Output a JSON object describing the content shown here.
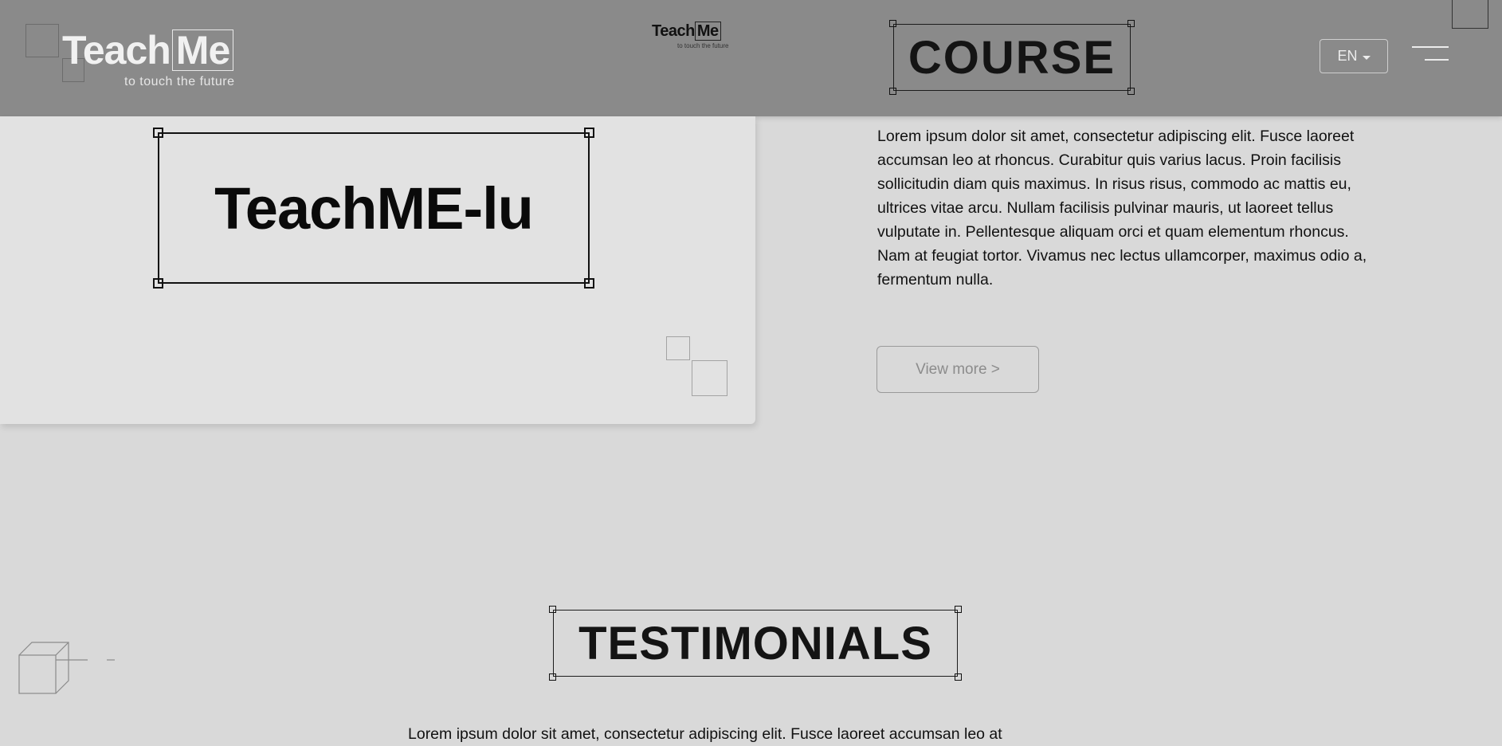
{
  "header": {
    "logo": {
      "word_part1": "Teach",
      "word_part2": "Me",
      "tagline": "to touch the future"
    },
    "mini_logo": {
      "word_part1": "Teach",
      "word_part2": "Me",
      "tagline": "to touch the future"
    },
    "section_title": "COURSE",
    "language": {
      "selected": "EN"
    }
  },
  "card": {
    "title": "TeachME-lu"
  },
  "course": {
    "description": "Lorem ipsum dolor sit amet, consectetur adipiscing elit. Fusce laoreet accumsan leo at rhoncus. Curabitur quis varius lacus. Proin facilisis sollicitudin diam quis maximus. In risus risus, commodo ac mattis eu, ultrices vitae arcu. Nullam facilisis pulvinar mauris, ut laoreet tellus vulputate in. Pellentesque aliquam orci et quam elementum rhoncus. Nam at feugiat tortor. Vivamus nec lectus ullamcorper, maximus odio a, fermentum nulla.",
    "button_label": "View more >"
  },
  "testimonials": {
    "title": "TESTIMONIALS",
    "text": "Lorem ipsum dolor sit amet, consectetur adipiscing elit. Fusce laoreet accumsan leo at"
  },
  "icons": [
    "menu-icon",
    "chevron-down-icon",
    "cube-icon"
  ],
  "colors": {
    "header_bg": "#8a8a8a",
    "page_bg": "#d9d9d9",
    "card_bg": "#e2e2e2",
    "text": "#111111"
  }
}
